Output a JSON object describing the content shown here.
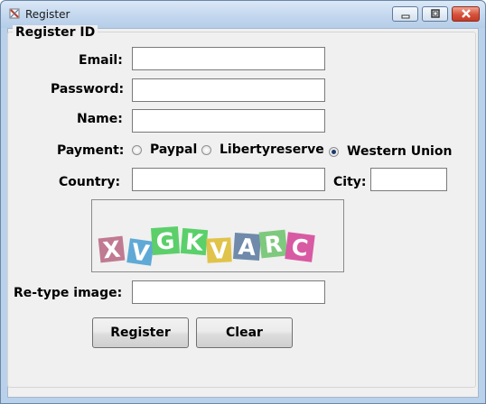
{
  "window": {
    "title": "Register"
  },
  "form": {
    "group_title": "Register ID",
    "email_label": "Email:",
    "email_value": "",
    "password_label": "Password:",
    "password_value": "",
    "name_label": "Name:",
    "name_value": "",
    "payment_label": "Payment:",
    "payment_options": [
      "Paypal",
      "Libertyreserve",
      "Western Union"
    ],
    "payment_selected": "Western Union",
    "country_label": "Country:",
    "country_value": "",
    "city_label": "City:",
    "city_value": "",
    "captcha": {
      "letters": [
        "X",
        "V",
        "G",
        "K",
        "V",
        "A",
        "R",
        "C"
      ],
      "colors": [
        "#c07a92",
        "#5fa9d6",
        "#5ccf6a",
        "#5ad06a",
        "#e0c34a",
        "#6f8aaa",
        "#7fc97f",
        "#d85aa3"
      ]
    },
    "retype_label": "Re-type image:",
    "retype_value": "",
    "register_label": "Register",
    "clear_label": "Clear"
  }
}
